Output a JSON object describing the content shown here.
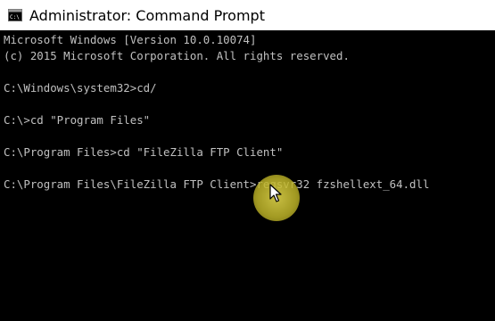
{
  "window": {
    "title": "Administrator: Command Prompt",
    "icon": "console-icon"
  },
  "console": {
    "lines": [
      "Microsoft Windows [Version 10.0.10074]",
      "(c) 2015 Microsoft Corporation. All rights reserved.",
      "",
      "C:\\Windows\\system32>cd/",
      "",
      "C:\\>cd \"Program Files\"",
      "",
      "C:\\Program Files>cd \"FileZilla FTP Client\"",
      "",
      "C:\\Program Files\\FileZilla FTP Client>regsvr32 fzshellext_64.dll"
    ]
  },
  "colors": {
    "titlebar_bg": "#ffffff",
    "console_bg": "#000000",
    "console_text": "#c0c0c0",
    "cursor_highlight": "#d2c846"
  }
}
